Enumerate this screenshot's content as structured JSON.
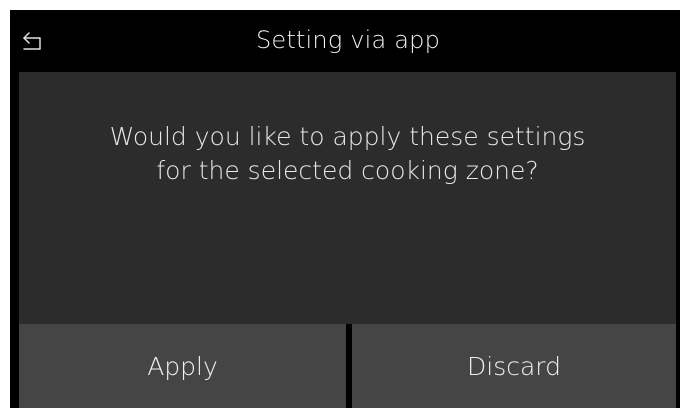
{
  "header": {
    "title": "Setting via app",
    "back_icon": "back-arrow-icon"
  },
  "dialog": {
    "message_line1": "Would you like to apply these settings",
    "message_line2": "for the selected cooking zone?"
  },
  "actions": {
    "apply_label": "Apply",
    "discard_label": "Discard"
  },
  "colors": {
    "background": "#000000",
    "panel": "#2c2c2c",
    "button": "#454545",
    "text": "#f2f2f2"
  }
}
